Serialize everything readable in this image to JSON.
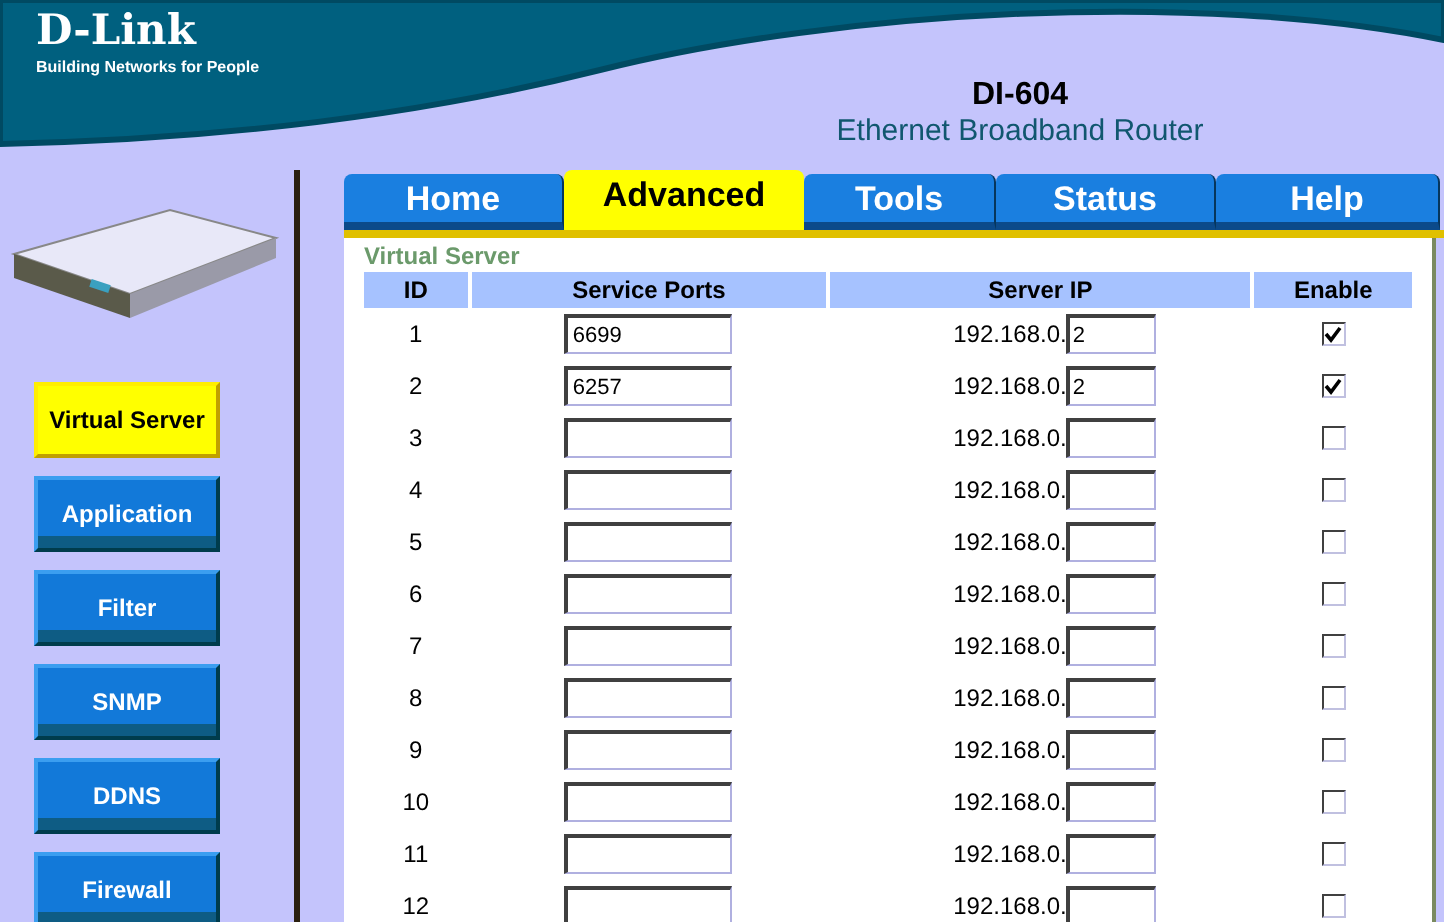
{
  "brand": {
    "logo": "D-Link",
    "tagline": "Building Networks for People"
  },
  "product": {
    "model": "DI-604",
    "subtitle": "Ethernet Broadband Router"
  },
  "tabs": [
    {
      "label": "Home",
      "selected": false
    },
    {
      "label": "Advanced",
      "selected": true
    },
    {
      "label": "Tools",
      "selected": false
    },
    {
      "label": "Status",
      "selected": false
    },
    {
      "label": "Help",
      "selected": false
    }
  ],
  "sidebar": {
    "items": [
      {
        "label": "Virtual Server",
        "selected": true
      },
      {
        "label": "Application",
        "selected": false
      },
      {
        "label": "Filter",
        "selected": false
      },
      {
        "label": "SNMP",
        "selected": false
      },
      {
        "label": "DDNS",
        "selected": false
      },
      {
        "label": "Firewall",
        "selected": false
      }
    ]
  },
  "section_title": "Virtual Server",
  "table": {
    "columns": [
      "ID",
      "Service Ports",
      "Server IP",
      "Enable"
    ],
    "rows": [
      {
        "id": "1",
        "ports": "6699",
        "ip_prefix": "192.168.0.",
        "ip_suffix": "2",
        "enabled": true
      },
      {
        "id": "2",
        "ports": "6257",
        "ip_prefix": "192.168.0.",
        "ip_suffix": "2",
        "enabled": true
      },
      {
        "id": "3",
        "ip_prefix": "192.168.0.",
        "enabled": false
      },
      {
        "id": "4",
        "ip_prefix": "192.168.0.",
        "enabled": false
      },
      {
        "id": "5",
        "ip_prefix": "192.168.0.",
        "enabled": false
      },
      {
        "id": "6",
        "ip_prefix": "192.168.0.",
        "enabled": false
      },
      {
        "id": "7",
        "ip_prefix": "192.168.0.",
        "enabled": false
      },
      {
        "id": "8",
        "ip_prefix": "192.168.0.",
        "enabled": false
      },
      {
        "id": "9",
        "ip_prefix": "192.168.0.",
        "enabled": false
      },
      {
        "id": "10",
        "ip_prefix": "192.168.0.",
        "enabled": false
      },
      {
        "id": "11",
        "ip_prefix": "192.168.0.",
        "enabled": false
      },
      {
        "id": "12",
        "ip_prefix": "192.168.0.",
        "enabled": false
      }
    ]
  }
}
